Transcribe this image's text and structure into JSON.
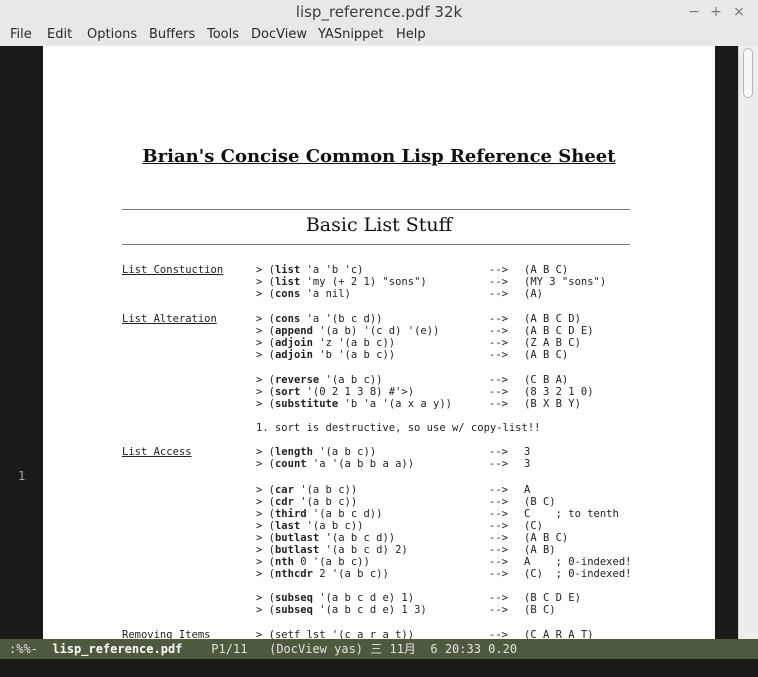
{
  "window": {
    "title": "lisp_reference.pdf  32k",
    "minimize_icon": "−",
    "maximize_icon": "+",
    "close_icon": "×"
  },
  "menu": [
    "File",
    "Edit",
    "Options",
    "Buffers",
    "Tools",
    "DocView",
    "YASnippet",
    "Help"
  ],
  "fringe_line_number": "1",
  "document": {
    "title": "Brian's Concise Common Lisp Reference Sheet",
    "section": "Basic List Stuff",
    "categories": [
      "List Constuction",
      "List Alteration",
      "List Access",
      "Removing Items"
    ],
    "note": "1. sort is destructive, so use w/ copy-list!!",
    "rows": [
      {
        "fn": "list",
        "args": " 'a 'b 'c)",
        "result": "(A B C)"
      },
      {
        "fn": "list",
        "args": " 'my (+ 2 1) \"sons\")",
        "result": "(MY 3 \"sons\")"
      },
      {
        "fn": "cons",
        "args": " 'a nil)",
        "result": "(A)"
      },
      {
        "fn": "cons",
        "args": " 'a '(b c d))",
        "result": "(A B C D)"
      },
      {
        "fn": "append",
        "args": " '(a b) '(c d) '(e))",
        "result": "(A B C D E)"
      },
      {
        "fn": "adjoin",
        "args": " 'z '(a b c))",
        "result": "(Z A B C)"
      },
      {
        "fn": "adjoin",
        "args": " 'b '(a b c))",
        "result": "(A B C)"
      },
      {
        "fn": "reverse",
        "args": " '(a b c))",
        "result": "(C B A)"
      },
      {
        "fn": "sort",
        "args": " '(0 2 1 3 8) #'>)",
        "result": "(8 3 2 1 0)"
      },
      {
        "fn": "substitute",
        "args": " 'b 'a '(a x a y))",
        "result": "(B X B Y)"
      },
      {
        "fn": "length",
        "args": " '(a b c))",
        "result": "3"
      },
      {
        "fn": "count",
        "args": " 'a '(a b b a a))",
        "result": "3"
      },
      {
        "fn": "car",
        "args": " '(a b c))",
        "result": "A"
      },
      {
        "fn": "cdr",
        "args": " '(a b c))",
        "result": "(B C)"
      },
      {
        "fn": "third",
        "args": " '(a b c d))",
        "result": "C    ; to tenth"
      },
      {
        "fn": "last",
        "args": " '(a b c))",
        "result": "(C)"
      },
      {
        "fn": "butlast",
        "args": " '(a b c d))",
        "result": "(A B C)"
      },
      {
        "fn": "butlast",
        "args": " '(a b c d) 2)",
        "result": "(A B)"
      },
      {
        "fn": "nth",
        "args": " 0 '(a b c))",
        "result": "A    ; 0-indexed!"
      },
      {
        "fn": "nthcdr",
        "args": " 2 '(a b c))",
        "result": "(C)  ; 0-indexed!"
      },
      {
        "fn": "subseq",
        "args": " '(a b c d e) 1)",
        "result": "(B C D E)"
      },
      {
        "fn": "subseq",
        "args": " '(a b c d e) 1 3)",
        "result": "(B C)"
      },
      {
        "fn": "",
        "args": "(setf lst '(c a r a t))",
        "result": "(C A R A T)"
      }
    ],
    "prompt": "> ",
    "arrow": "-->"
  },
  "modeline": {
    "state": ":%%-",
    "buffer": "lisp_reference.pdf",
    "rest": "    P1/11   (DocView yas) 三 11月  6 20:33 0.20"
  }
}
